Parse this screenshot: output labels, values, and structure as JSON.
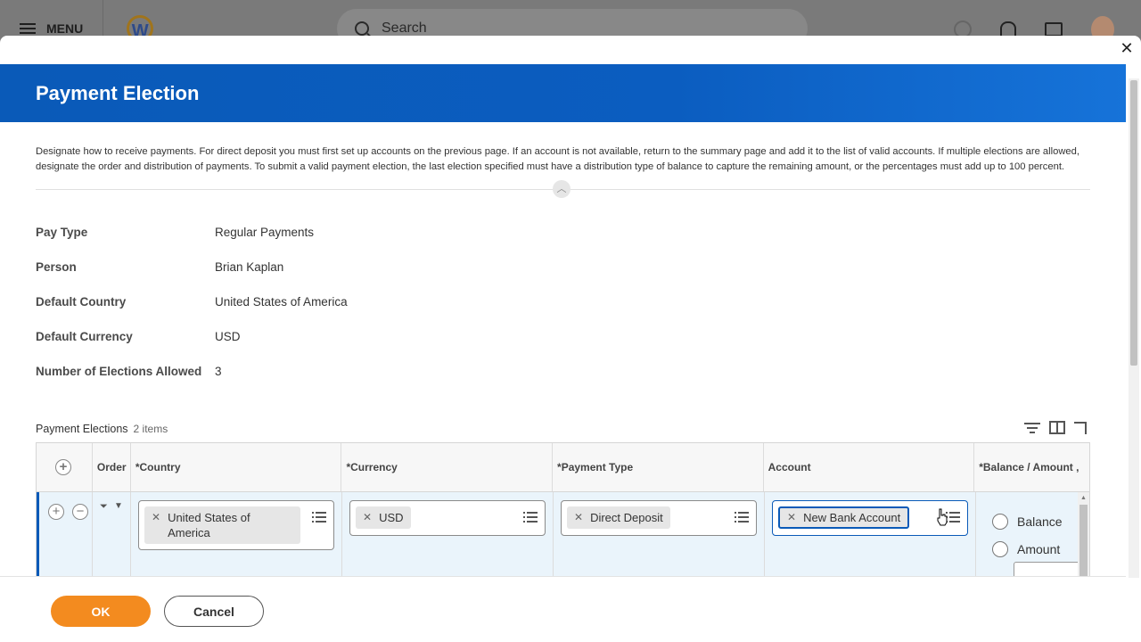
{
  "appbar": {
    "menu_label": "MENU",
    "logo_letter": "W",
    "search_placeholder": "Search"
  },
  "modal": {
    "title": "Payment Election",
    "close_symbol": "✕",
    "description": "Designate how to receive payments. For direct deposit you must first set up accounts on the previous page. If an account is not available, return to the summary page and add it to the list of valid accounts. If multiple elections are allowed, designate the order and distribution of payments. To submit a valid payment election, the last election specified must have a distribution type of balance to capture the remaining amount, or the percentages must add up to 100 percent."
  },
  "fields": [
    {
      "label": "Pay Type",
      "value": "Regular Payments"
    },
    {
      "label": "Person",
      "value": "Brian Kaplan"
    },
    {
      "label": "Default Country",
      "value": "United States of America"
    },
    {
      "label": "Default Currency",
      "value": "USD"
    },
    {
      "label": "Number of Elections Allowed",
      "value": "3"
    }
  ],
  "grid": {
    "title": "Payment Elections",
    "count": "2 items",
    "columns": {
      "order": "Order",
      "country": "*Country",
      "currency": "*Currency",
      "payment_type": "*Payment Type",
      "account": "Account",
      "balance_amount": "*Balance / Amount ,"
    },
    "row": {
      "country": "United States of America",
      "currency": "USD",
      "payment_type": "Direct Deposit",
      "account": "New Bank Account",
      "balance_label": "Balance",
      "amount_label": "Amount"
    }
  },
  "footer": {
    "ok_label": "OK",
    "cancel_label": "Cancel"
  },
  "colors": {
    "banner": "#0b5dc0",
    "ok_button": "#f38b1f",
    "row_highlight": "#eaf4fb"
  }
}
